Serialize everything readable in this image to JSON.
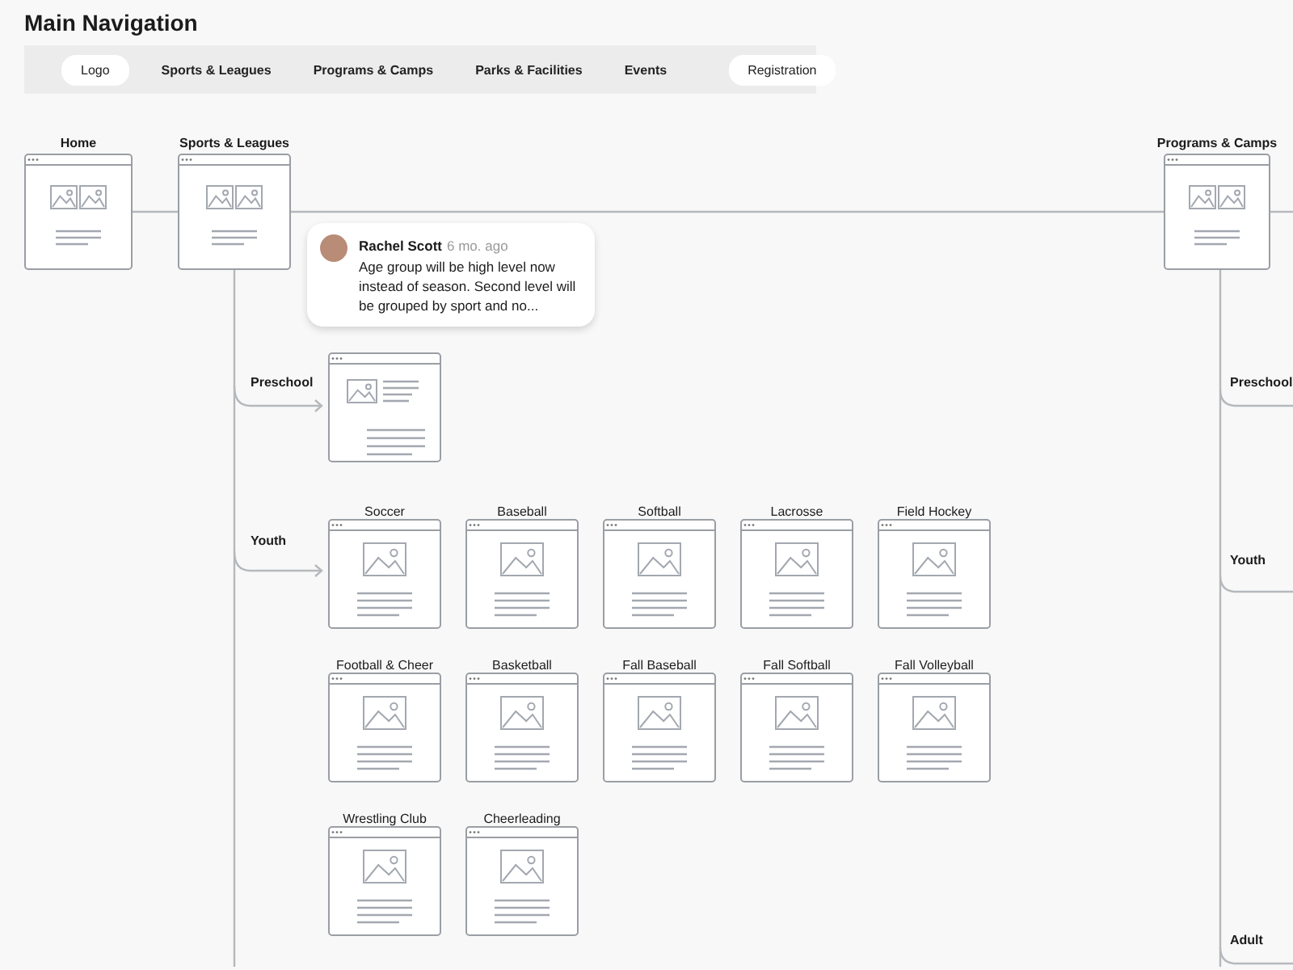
{
  "title": "Main Navigation",
  "nav_items": [
    {
      "label": "Logo",
      "kind": "pill"
    },
    {
      "label": "Sports & Leagues",
      "kind": "plain"
    },
    {
      "label": "Programs & Camps",
      "kind": "plain"
    },
    {
      "label": "Parks & Facilities",
      "kind": "plain"
    },
    {
      "label": "Events",
      "kind": "plain"
    },
    {
      "label": "Registration",
      "kind": "pill"
    }
  ],
  "top_pages": [
    {
      "label": "Home",
      "kind": "double"
    },
    {
      "label": "Sports & Leagues",
      "kind": "double"
    },
    {
      "label": "Programs & Camps",
      "kind": "double"
    }
  ],
  "comment": {
    "author": "Rachel Scott",
    "time": "6 mo. ago",
    "text": "Age group will be high level now instead of season. Second level will be grouped by sport and no..."
  },
  "sports_branches": [
    {
      "label": "Preschool",
      "pages": [
        {
          "kind": "side"
        }
      ]
    },
    {
      "label": "Youth",
      "pages": [
        {
          "label": "Soccer",
          "kind": "single"
        },
        {
          "label": "Baseball",
          "kind": "single"
        },
        {
          "label": "Softball",
          "kind": "single"
        },
        {
          "label": "Lacrosse",
          "kind": "single"
        },
        {
          "label": "Field Hockey",
          "kind": "single"
        },
        {
          "label": "Football & Cheer",
          "kind": "single"
        },
        {
          "label": "Basketball",
          "kind": "single"
        },
        {
          "label": "Fall Baseball",
          "kind": "single"
        },
        {
          "label": "Fall Softball",
          "kind": "single"
        },
        {
          "label": "Fall Volleyball",
          "kind": "single"
        },
        {
          "label": "Wrestling Club",
          "kind": "single"
        },
        {
          "label": "Cheerleading",
          "kind": "single"
        }
      ]
    }
  ],
  "programs_branches": [
    {
      "label": "Preschool"
    },
    {
      "label": "Youth"
    },
    {
      "label": "Adult"
    }
  ]
}
